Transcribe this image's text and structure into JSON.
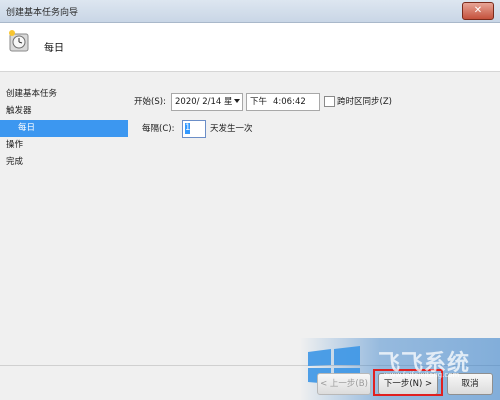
{
  "window": {
    "title": "创建基本任务向导",
    "close_glyph": "✕"
  },
  "header": {
    "title": "每日",
    "icon": "task-clock-icon"
  },
  "nav": {
    "items": [
      {
        "label": "创建基本任务",
        "selected": false,
        "sub": false
      },
      {
        "label": "触发器",
        "selected": false,
        "sub": false
      },
      {
        "label": "每日",
        "selected": true,
        "sub": true
      },
      {
        "label": "操作",
        "selected": false,
        "sub": false
      },
      {
        "label": "完成",
        "selected": false,
        "sub": false
      }
    ]
  },
  "form": {
    "start_label": "开始(S):",
    "date_value": "2020/ 2/14 星",
    "ampm": "下午",
    "time_value": "4:06:42",
    "sync_label": "跨时区同步(Z)",
    "sync_checked": false,
    "recur_label": "每隔(C):",
    "recur_value": "1",
    "recur_suffix": "天发生一次"
  },
  "buttons": {
    "back": "< 上一步(B)",
    "next": "下一步(N) >",
    "cancel": "取消"
  },
  "watermark": {
    "text": "飞飞系统",
    "url": "www.feifeixitong.com"
  },
  "colors": {
    "selection": "#3c97f0",
    "highlight_box": "#e02020"
  }
}
